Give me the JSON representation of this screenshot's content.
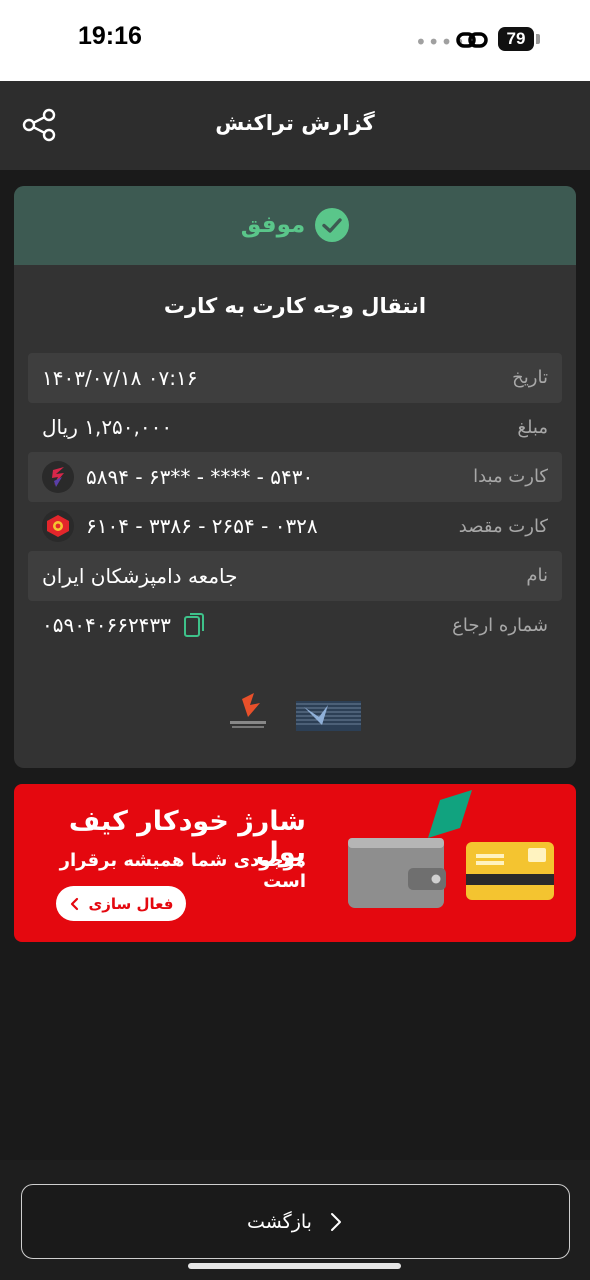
{
  "status_bar": {
    "time": "19:16",
    "battery": "79"
  },
  "header": {
    "title": "گزارش تراکنش"
  },
  "receipt": {
    "status": "موفق",
    "title": "انتقال وجه کارت به کارت",
    "rows": [
      {
        "label": "تاریخ",
        "value": "۱۴۰۳/۰۷/۱۸ ۰۷:۱۶"
      },
      {
        "label": "مبلغ",
        "value": "۱,۲۵۰,۰۰۰ ریال"
      },
      {
        "label": "کارت مبدا",
        "value": "۵۸۹۴ - ۶۳** - **** - ۵۴۳۰"
      },
      {
        "label": "کارت مقصد",
        "value": "۶۱۰۴ - ۳۳۸۶ - ۲۶۵۴ - ۰۳۲۸"
      },
      {
        "label": "نام",
        "value": "جامعه دامپزشکان ایران"
      },
      {
        "label": "شماره ارجاع",
        "value": "۰۵۹۰۴۰۶۶۲۴۳۳"
      }
    ]
  },
  "banner": {
    "title": "شارژ خودکار کیف پول",
    "subtitle": "موجودی شما همیشه برقرار است",
    "button": "فعال سازی"
  },
  "footer": {
    "back": "بازگشت"
  },
  "colors": {
    "success": "#5ac68a",
    "success_strip": "#3d5a52",
    "banner_red": "#e4080f"
  }
}
